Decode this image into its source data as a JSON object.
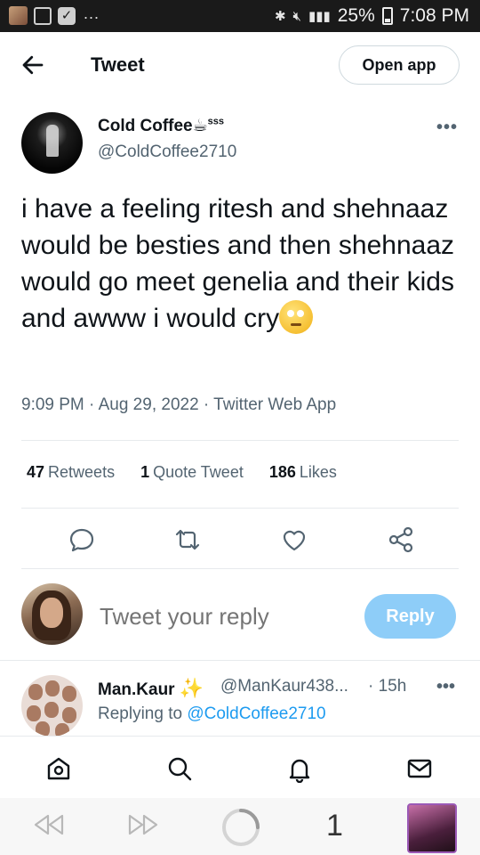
{
  "status_bar": {
    "battery": "25%",
    "time": "7:08 PM",
    "overflow": "..."
  },
  "header": {
    "title": "Tweet",
    "open_app": "Open app"
  },
  "tweet": {
    "author_name": "Cold Coffee",
    "author_name_suffix": "sss",
    "author_handle": "@ColdCoffee2710",
    "text": "i have a feeling ritesh and shehnaaz would be besties and then shehnaaz would go meet genelia and their kids and awww i would cry",
    "emoji": "rolling-eyes-emoji",
    "meta": "9:09 PM · Aug 29, 2022 · Twitter Web App",
    "stats": {
      "retweets_count": "47",
      "retweets_label": "Retweets",
      "quotes_count": "1",
      "quotes_label": "Quote Tweet",
      "likes_count": "186",
      "likes_label": "Likes"
    }
  },
  "composer": {
    "placeholder": "Tweet your reply",
    "reply_button": "Reply"
  },
  "reply": {
    "name": "Man.Kaur",
    "handle": "@ManKaur438...",
    "time": "· 15h",
    "replying_prefix": "Replying to",
    "replying_to": "@ColdCoffee2710"
  },
  "browser": {
    "tab_count": "1"
  },
  "colors": {
    "accent": "#1d9bf0",
    "reply_button_disabled": "#8ecdf8",
    "muted_text": "#536471"
  }
}
